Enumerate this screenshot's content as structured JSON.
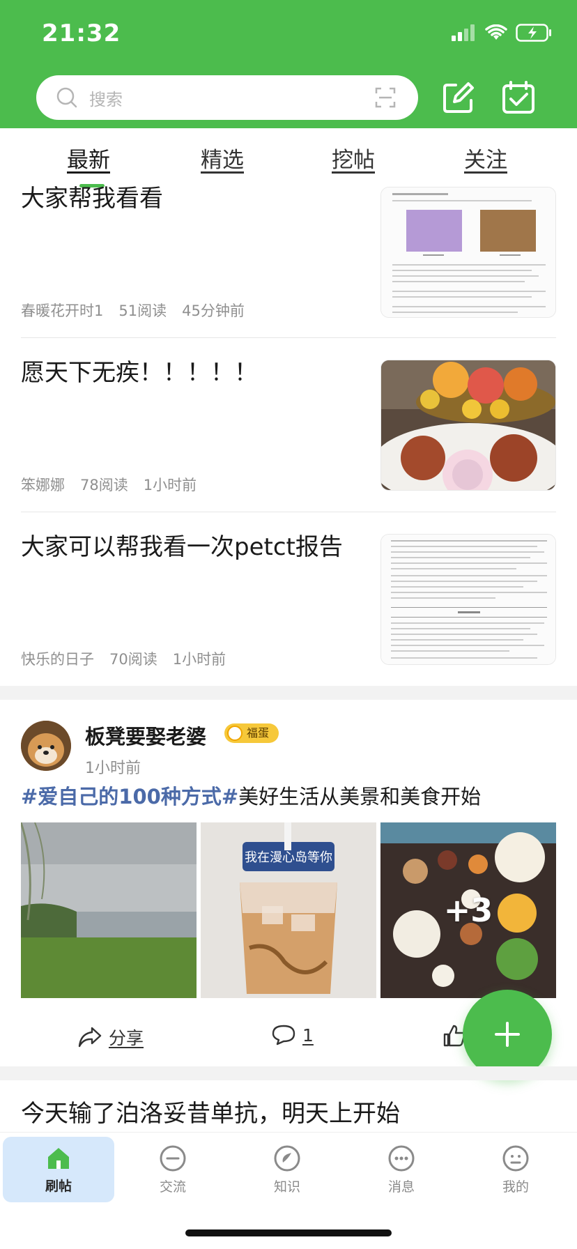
{
  "status_bar": {
    "time": "21:32"
  },
  "search": {
    "placeholder": "搜索"
  },
  "tabs": [
    {
      "label": "最新",
      "active": true
    },
    {
      "label": "精选"
    },
    {
      "label": "挖帖"
    },
    {
      "label": "关注"
    }
  ],
  "feed": [
    {
      "title": "大家帮我看看",
      "author": "春暖花开时1",
      "reads": "51阅读",
      "time": "45分钟前",
      "thumb": "document-report"
    },
    {
      "title": "愿天下无疾！！！！！",
      "author": "笨娜娜",
      "reads": "78阅读",
      "time": "1小时前",
      "thumb": "fruit-and-mooncakes"
    },
    {
      "title": "大家可以帮我看一次petct报告",
      "author": "快乐的日子",
      "reads": "70阅读",
      "time": "1小时前",
      "thumb": "document-report"
    }
  ],
  "social_post": {
    "author": "板凳要娶老婆",
    "badge": "福蛋",
    "time": "1小时前",
    "hashtag": "#爱自己的100种方式#",
    "text": "美好生活从美景和美食开始",
    "photos": [
      "lake-landscape",
      "iced-coffee",
      "meal-tray"
    ],
    "photo_overlay_text": "我在漫心岛等你",
    "more_photos": "+3",
    "actions": {
      "share": "分享",
      "comments": "1"
    }
  },
  "next_post": {
    "title": "今天输了泊洛妥昔单抗，明天上开始"
  },
  "bottom_nav": [
    {
      "label": "刷帖",
      "icon": "home-icon",
      "active": true
    },
    {
      "label": "交流",
      "icon": "chat-icon"
    },
    {
      "label": "知识",
      "icon": "knowledge-icon"
    },
    {
      "label": "消息",
      "icon": "message-icon"
    },
    {
      "label": "我的",
      "icon": "profile-icon"
    }
  ],
  "colors": {
    "brand_green": "#4cbc4d",
    "hashtag": "#4b6aa8",
    "badge": "#f6c83a",
    "nav_active_bg": "#d6e8fb"
  }
}
